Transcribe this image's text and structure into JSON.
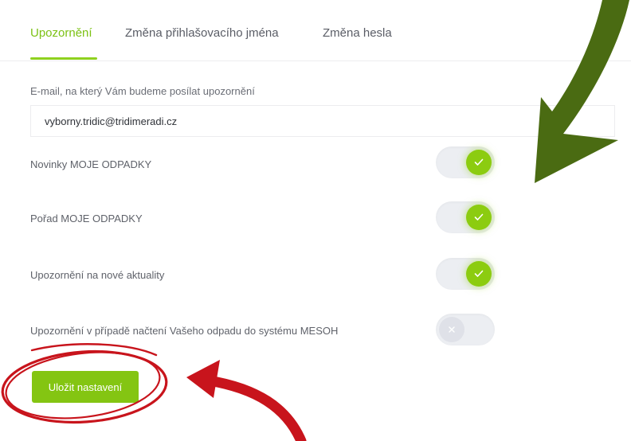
{
  "tabs": [
    {
      "label": "Upozornění",
      "active": true
    },
    {
      "label": "Změna přihlašovacího jména",
      "active": false
    },
    {
      "label": "Změna hesla",
      "active": false
    }
  ],
  "email": {
    "label": "E-mail, na který Vám budeme posílat upozornění",
    "value": "vyborny.tridic@tridimeradi.cz"
  },
  "settings": [
    {
      "label": "Novinky MOJE ODPADKY",
      "enabled": true
    },
    {
      "label": "Pořad MOJE ODPADKY",
      "enabled": true
    },
    {
      "label": "Upozornění na nové aktuality",
      "enabled": true
    },
    {
      "label": "Upozornění v případě načtení Vašeho odpadu do systému MESOH",
      "enabled": false
    }
  ],
  "save_label": "Uložit nastavení",
  "colors": {
    "accent": "#84c512",
    "annotation_arrow_green": "#4a6b12",
    "annotation_red": "#c8141c"
  }
}
